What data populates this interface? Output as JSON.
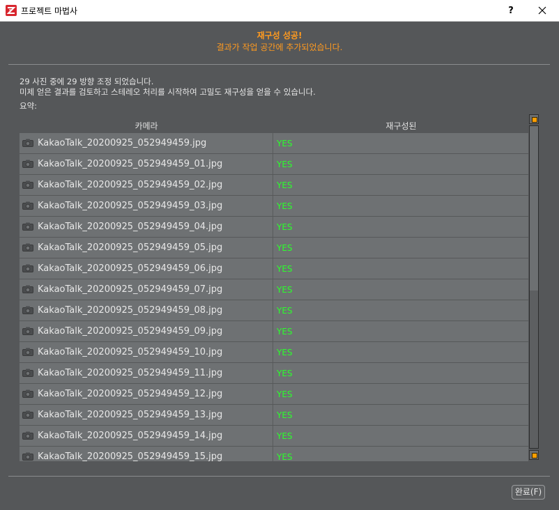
{
  "window": {
    "title": "프로젝트 마법사",
    "help_label": "?",
    "close_label": "✕"
  },
  "header": {
    "success_title": "재구성 성공!",
    "success_subtitle": "결과가 작업 공간에 추가되었습니다."
  },
  "info": {
    "line1": "29 사진 중에 29 방향 조정 되었습니다.",
    "line2": "미제 얻은 결과를 검토하고 스테레오 처리를 시작하여 고밀도 재구성을 얻을 수 있습니다.",
    "summary_label": "요약:"
  },
  "table": {
    "columns": [
      "카메라",
      "재구성된"
    ],
    "rows": [
      {
        "camera": "KakaoTalk_20200925_052949459.jpg",
        "status": "YES"
      },
      {
        "camera": "KakaoTalk_20200925_052949459_01.jpg",
        "status": "YES"
      },
      {
        "camera": "KakaoTalk_20200925_052949459_02.jpg",
        "status": "YES"
      },
      {
        "camera": "KakaoTalk_20200925_052949459_03.jpg",
        "status": "YES"
      },
      {
        "camera": "KakaoTalk_20200925_052949459_04.jpg",
        "status": "YES"
      },
      {
        "camera": "KakaoTalk_20200925_052949459_05.jpg",
        "status": "YES"
      },
      {
        "camera": "KakaoTalk_20200925_052949459_06.jpg",
        "status": "YES"
      },
      {
        "camera": "KakaoTalk_20200925_052949459_07.jpg",
        "status": "YES"
      },
      {
        "camera": "KakaoTalk_20200925_052949459_08.jpg",
        "status": "YES"
      },
      {
        "camera": "KakaoTalk_20200925_052949459_09.jpg",
        "status": "YES"
      },
      {
        "camera": "KakaoTalk_20200925_052949459_10.jpg",
        "status": "YES"
      },
      {
        "camera": "KakaoTalk_20200925_052949459_11.jpg",
        "status": "YES"
      },
      {
        "camera": "KakaoTalk_20200925_052949459_12.jpg",
        "status": "YES"
      },
      {
        "camera": "KakaoTalk_20200925_052949459_13.jpg",
        "status": "YES"
      },
      {
        "camera": "KakaoTalk_20200925_052949459_14.jpg",
        "status": "YES"
      },
      {
        "camera": "KakaoTalk_20200925_052949459_15.jpg",
        "status": "YES"
      }
    ],
    "row_icon": "camera-icon",
    "scroll_position": 0.0
  },
  "footer": {
    "finish_label": "완료(F)"
  },
  "colors": {
    "background": "#555759",
    "accent": "#ff9a1f",
    "status_yes": "#2bff2b",
    "row_bg": "#6e7173"
  }
}
